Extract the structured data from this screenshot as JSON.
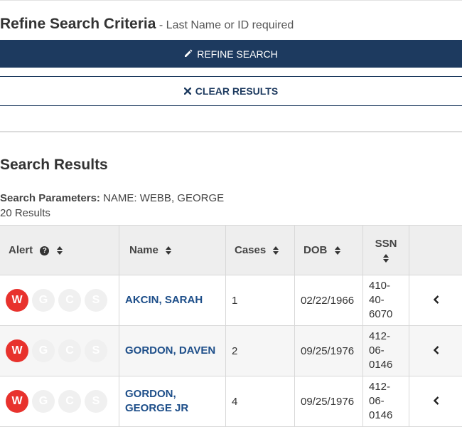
{
  "refine": {
    "title": "Refine Search Criteria",
    "subtitle": "- Last Name or ID required",
    "refine_button": "REFINE SEARCH",
    "clear_button": "CLEAR RESULTS"
  },
  "results": {
    "title": "Search Results",
    "params_label": "Search Parameters:",
    "params_value": "NAME: WEBB, GEORGE",
    "count": "20 Results"
  },
  "table": {
    "headers": {
      "alert": "Alert",
      "name": "Name",
      "cases": "Cases",
      "dob": "DOB",
      "ssn": "SSN"
    },
    "rows": [
      {
        "badges": [
          "W",
          "G",
          "C",
          "S"
        ],
        "name": "AKCIN, SARAH",
        "cases": "1",
        "dob": "02/22/1966",
        "ssn": "410-\n40-\n6070"
      },
      {
        "badges": [
          "W",
          "G",
          "C",
          "S"
        ],
        "name": "GORDON, DAVEN",
        "cases": "2",
        "dob": "09/25/1976",
        "ssn": "412-\n06-\n0146"
      },
      {
        "badges": [
          "W",
          "G",
          "C",
          "S"
        ],
        "name": "GORDON, GEORGE JR",
        "cases": "4",
        "dob": "09/25/1976",
        "ssn": "412-\n06-\n0146"
      }
    ]
  },
  "colors": {
    "primary": "#1d3a5f",
    "alert_active": "#e8322d",
    "badge_inactive": "#f0f0f0",
    "link": "#1d4e89"
  },
  "icons": {
    "refine": "pencil-icon",
    "clear": "times-icon",
    "sort": "sort-icon",
    "help": "question-circle-icon",
    "expand": "chevron-left-icon"
  }
}
